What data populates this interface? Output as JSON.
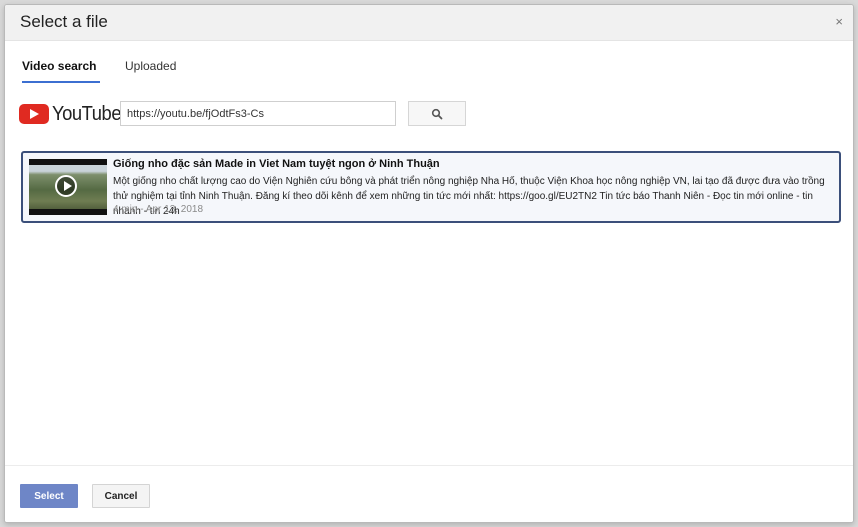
{
  "dialog": {
    "title": "Select a file",
    "close_glyph": "×"
  },
  "tabs": [
    {
      "label": "Video search",
      "active": true
    },
    {
      "label": "Uploaded",
      "active": false
    }
  ],
  "search": {
    "logo_text": "YouTube",
    "query": "https://youtu.be/fjOdtFs3-Cs",
    "button_icon": "search-icon"
  },
  "results": [
    {
      "title": "Giống nho đặc sản Made in Viet Nam tuyệt ngon ở Ninh Thuận",
      "description": "Một giống nho chất lượng cao do Viện Nghiên cứu bông và phát triển nông nghiệp Nha Hố, thuộc Viện Khoa học nông nghiệp VN, lai tạo đã được đưa vào trồng thử nghiệm tại tỉnh Ninh Thuận. Đăng kí theo dõi kênh để xem những tin tức mới nhất: https://goo.gl/EU2TN2 Tin tức báo Thanh Niên - Đọc tin mới online - tin nhanh - tin 24h",
      "meta": "4 min - Apr 13, 2018",
      "selected": true
    }
  ],
  "footer": {
    "select_label": "Select",
    "cancel_label": "Cancel"
  },
  "colors": {
    "accent": "#3c6fd1",
    "select_button": "#6e86c7",
    "youtube_red": "#e02a21",
    "selected_border": "#3b4f7a"
  }
}
